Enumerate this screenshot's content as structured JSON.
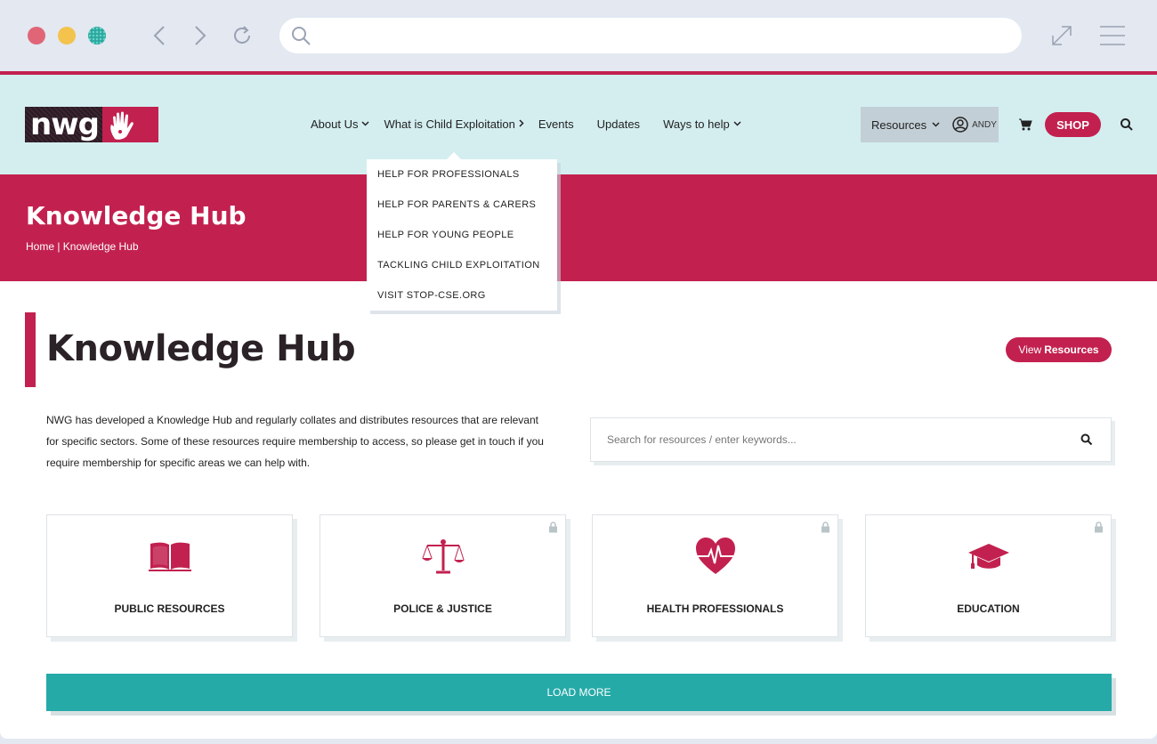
{
  "browser": {
    "url": "",
    "url_placeholder": ""
  },
  "brand": {
    "logo_text": "nwg",
    "primary_color": "#c2214f",
    "header_bg": "#d4eef0",
    "accent_teal": "#25aaa8"
  },
  "nav": {
    "items": [
      {
        "label": "About Us",
        "has_dropdown": true
      },
      {
        "label": "What is Child Exploitation",
        "has_submenu": true
      },
      {
        "label": "Events"
      },
      {
        "label": "Updates"
      },
      {
        "label": "Ways to help",
        "has_dropdown": true
      }
    ],
    "resources_label": "Resources",
    "user_label": "ANDY",
    "shop_label": "SHOP"
  },
  "dropdown": {
    "items": [
      "HELP FOR PROFESSIONALS",
      "HELP FOR PARENTS & CARERS",
      "HELP FOR YOUNG PEOPLE",
      "TACKLING CHILD EXPLOITATION",
      "VISIT STOP-CSE.ORG"
    ]
  },
  "hero": {
    "title": "Knowledge Hub",
    "breadcrumb": "Home | Knowledge Hub"
  },
  "main": {
    "title": "Knowledge Hub",
    "view_resources_prefix": "View",
    "view_resources_bold": "Resources",
    "intro": "NWG has developed a Knowledge Hub and regularly collates and distributes resources that are relevant for specific sectors. Some of these resources require membership to access, so please get in touch if you require membership for specific areas we can help with.",
    "search_placeholder": "Search for resources / enter keywords...",
    "cards": [
      {
        "label": "PUBLIC RESOURCES",
        "icon": "book-icon",
        "locked": false
      },
      {
        "label": "POLICE & JUSTICE",
        "icon": "scales-icon",
        "locked": true
      },
      {
        "label": "HEALTH PROFESSIONALS",
        "icon": "heartbeat-icon",
        "locked": true
      },
      {
        "label": "EDUCATION",
        "icon": "graduation-cap-icon",
        "locked": true
      }
    ],
    "load_more_label": "LOAD MORE"
  }
}
